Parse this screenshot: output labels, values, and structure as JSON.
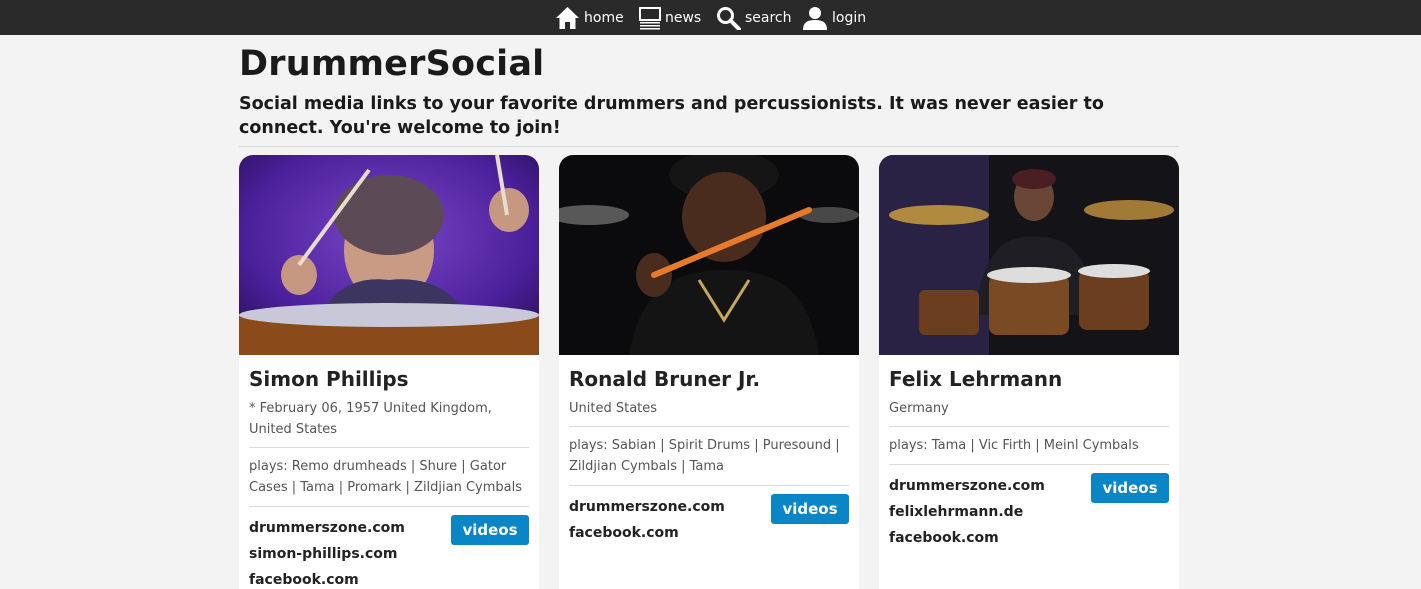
{
  "nav": {
    "home": {
      "label": "home",
      "icon": "home-icon"
    },
    "news": {
      "label": "news",
      "icon": "news-icon"
    },
    "search": {
      "label": "search",
      "icon": "search-icon"
    },
    "login": {
      "label": "login",
      "icon": "user-icon"
    }
  },
  "header": {
    "title": "DrummerSocial",
    "tagline": "Social media links to your favorite drummers and percussionists. It was never easier to connect. You're welcome to join!"
  },
  "cards": [
    {
      "name": "Simon Phillips",
      "meta": "* February 06, 1957 United Kingdom, United States",
      "plays": "plays: Remo drumheads | Shure | Gator Cases | Tama | Promark | Zildjian Cymbals",
      "links": [
        "drummerszone.com",
        "simon-phillips.com",
        "facebook.com"
      ],
      "videos_label": "videos"
    },
    {
      "name": "Ronald Bruner Jr.",
      "meta": "United States",
      "plays": "plays: Sabian | Spirit Drums | Puresound | Zildjian Cymbals | Tama",
      "links": [
        "drummerszone.com",
        "facebook.com"
      ],
      "videos_label": "videos"
    },
    {
      "name": "Felix Lehrmann",
      "meta": "Germany",
      "plays": "plays: Tama | Vic Firth | Meinl Cymbals",
      "links": [
        "drummerszone.com",
        "felixlehrmann.de",
        "facebook.com"
      ],
      "videos_label": "videos"
    }
  ],
  "colors": {
    "topbar": "#2a2a2a",
    "accent": "#0a86c6",
    "background": "#f3f3f3"
  }
}
